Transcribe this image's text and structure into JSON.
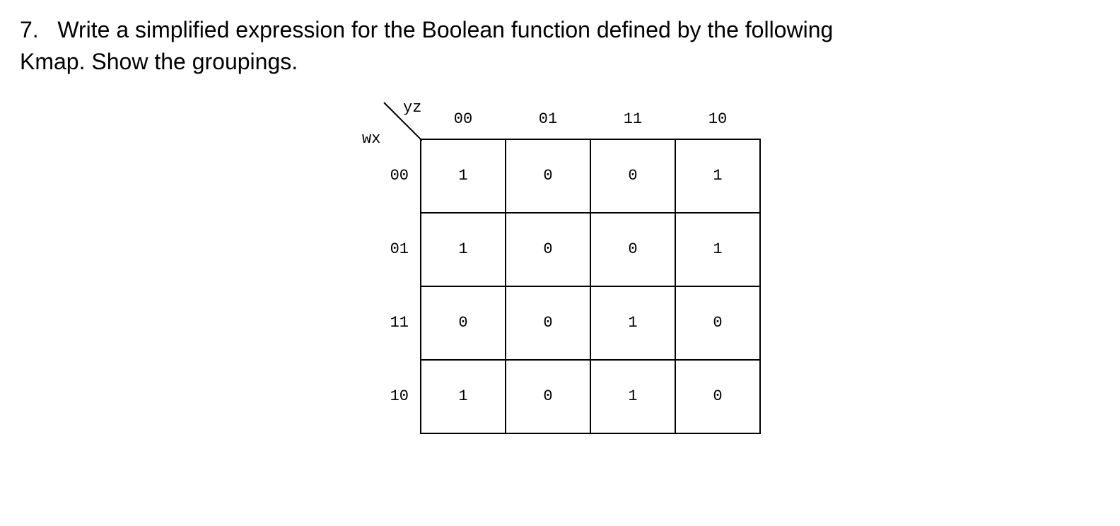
{
  "question": {
    "number": "7.",
    "text_line1": "Write a simplified expression for the Boolean function defined by the following",
    "text_line2": "Kmap.  Show the groupings."
  },
  "kmap": {
    "col_var": "yz",
    "row_var": "wx",
    "col_headers": [
      "00",
      "01",
      "11",
      "10"
    ],
    "row_headers": [
      "00",
      "01",
      "11",
      "10"
    ],
    "cells": [
      [
        "1",
        "0",
        "0",
        "1"
      ],
      [
        "1",
        "0",
        "0",
        "1"
      ],
      [
        "0",
        "0",
        "1",
        "0"
      ],
      [
        "1",
        "0",
        "1",
        "0"
      ]
    ]
  }
}
